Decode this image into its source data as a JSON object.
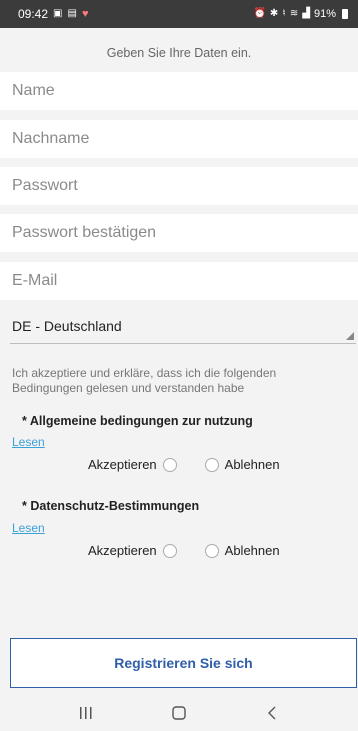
{
  "status_bar": {
    "time": "09:42",
    "battery": "91%",
    "icons_left": [
      "gallery-icon",
      "screenshot-icon",
      "heart-icon"
    ],
    "icons_right": [
      "alarm-icon",
      "bluetooth-icon",
      "mute-icon",
      "wifi-icon",
      "signal-icon",
      "battery-icon"
    ]
  },
  "form": {
    "subtitle": "Geben Sie Ihre Daten ein.",
    "fields": [
      {
        "placeholder": "Name",
        "value": ""
      },
      {
        "placeholder": "Nachname",
        "value": ""
      },
      {
        "placeholder": "Passwort",
        "value": ""
      },
      {
        "placeholder": "Passwort bestätigen",
        "value": ""
      },
      {
        "placeholder": "E-Mail",
        "value": ""
      }
    ],
    "country_value": "DE - Deutschland"
  },
  "terms": {
    "intro": "Ich akzeptiere und erkläre, dass ich die folgenden Bedingungen gelesen und verstanden habe",
    "sections": [
      {
        "title": "* Allgemeine bedingungen zur nutzung",
        "read_label": "Lesen",
        "accept_label": "Akzeptieren",
        "reject_label": "Ablehnen"
      },
      {
        "title": "* Datenschutz-Bestimmungen",
        "read_label": "Lesen",
        "accept_label": "Akzeptieren",
        "reject_label": "Ablehnen"
      }
    ]
  },
  "register_button": "Registrieren Sie sich",
  "colors": {
    "accent": "#2f5fa8",
    "link": "#3aa0d8",
    "status_bar": "#3b3b3b",
    "background": "#f3f3f3"
  }
}
